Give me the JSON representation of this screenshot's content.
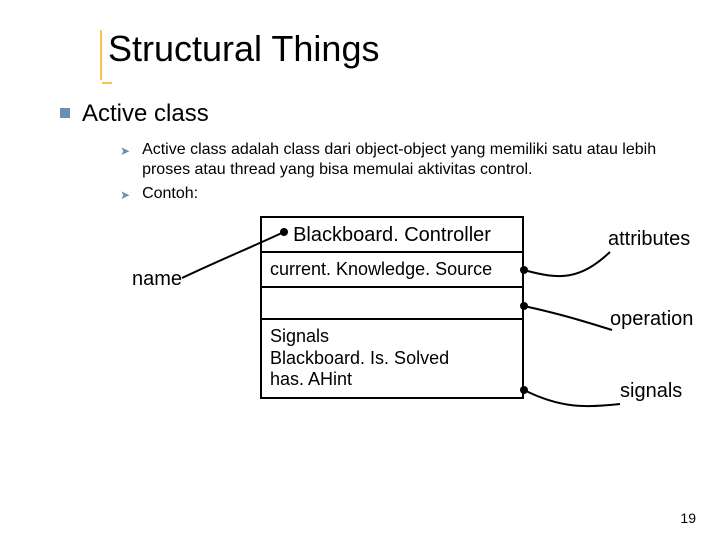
{
  "title": "Structural Things",
  "level1": "Active class",
  "bullets": [
    "Active class adalah class dari object-object yang memiliki satu atau lebih proses atau thread yang bisa memulai aktivitas control.",
    "Contoh:"
  ],
  "uml": {
    "name": "Blackboard. Controller",
    "attribute": "current. Knowledge. Source",
    "signals_header": "Signals",
    "signal1": "Blackboard. Is. Solved",
    "signal2": "has. AHint"
  },
  "labels": {
    "name": "name",
    "attributes": "attributes",
    "operation": "operation",
    "signals": "signals"
  },
  "page_number": "19"
}
